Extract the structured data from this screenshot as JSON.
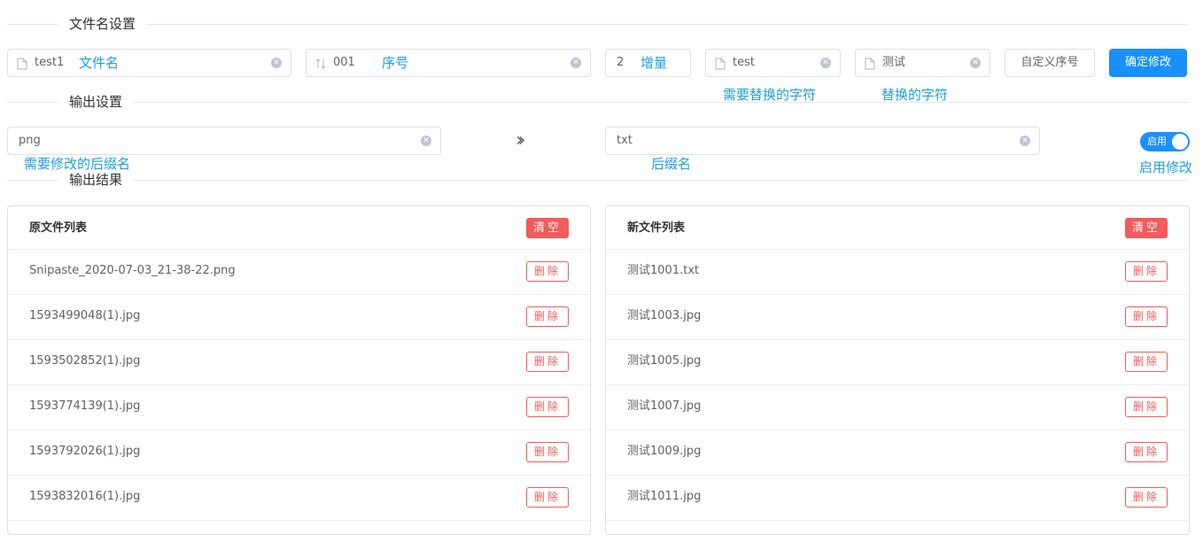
{
  "sections": {
    "filename_settings": "文件名设置",
    "output_settings": "输出设置",
    "output_results": "输出结果"
  },
  "filename": {
    "name_value": "test1",
    "name_hint": "文件名",
    "seq_value": "001",
    "seq_hint": "序号",
    "increment_value": "2",
    "increment_hint": "增量",
    "find_value": "test",
    "find_hint": "需要替换的字符",
    "replace_value": "测试",
    "replace_hint": "替换的字符",
    "custom_seq_button": "自定义序号",
    "confirm_button": "确定修改"
  },
  "output": {
    "old_ext_value": "png",
    "old_ext_hint": "需要修改的后缀名",
    "new_ext_value": "txt",
    "new_ext_hint": "后缀名",
    "switch_label": "启用",
    "switch_hint": "启用修改",
    "switch_on": true
  },
  "original_list": {
    "title": "原文件列表",
    "clear_label": "清空",
    "delete_label": "删除",
    "files": [
      "Snipaste_2020-07-03_21-38-22.png",
      "1593499048(1).jpg",
      "1593502852(1).jpg",
      "1593774139(1).jpg",
      "1593792026(1).jpg",
      "1593832016(1).jpg"
    ]
  },
  "new_list": {
    "title": "新文件列表",
    "clear_label": "清空",
    "delete_label": "删除",
    "files": [
      "测试1001.txt",
      "测试1003.jpg",
      "测试1005.jpg",
      "测试1007.jpg",
      "测试1009.jpg",
      "测试1011.jpg"
    ]
  },
  "colors": {
    "primary": "#1890ff",
    "danger": "#f25b5b",
    "hint": "#1e9fd9",
    "border": "#dcdfe6"
  }
}
